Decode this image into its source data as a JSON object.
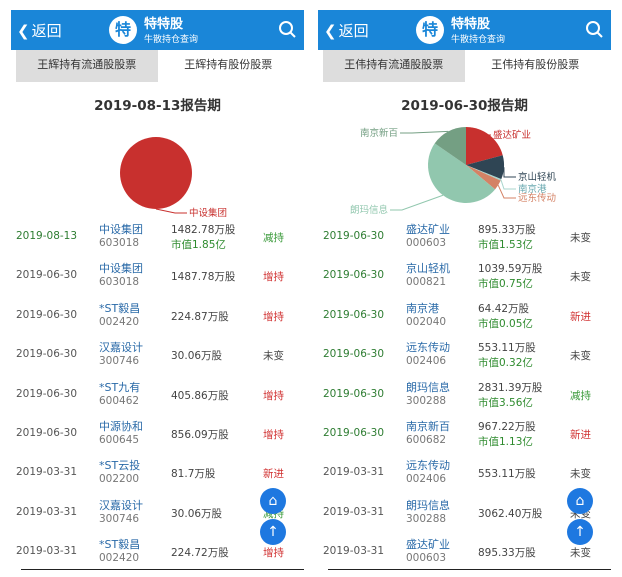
{
  "app": {
    "back_label": "返回",
    "logo_char": "特",
    "title": "特特股",
    "subtitle": "牛散持仓查询"
  },
  "panels": [
    {
      "tabs": [
        "王辉持有流通股股票",
        "王辉持有股份股票"
      ],
      "active_tab": 0,
      "report_title": "2019-08-13报告期",
      "chart_data": {
        "type": "pie",
        "slices": [
          {
            "name": "中设集团",
            "value": 1.85,
            "color": "#c8302e"
          }
        ]
      },
      "rows": [
        {
          "date": "2019-08-13",
          "name": "中设集团",
          "code": "603018",
          "shares": "1482.78万股",
          "mv": "市值1.85亿",
          "status": "减持",
          "sc": "grn",
          "hl": true
        },
        {
          "date": "2019-06-30",
          "name": "中设集团",
          "code": "603018",
          "shares": "1487.78万股",
          "status": "增持",
          "sc": "red"
        },
        {
          "date": "2019-06-30",
          "name": "*ST毅昌",
          "code": "002420",
          "shares": "224.87万股",
          "status": "增持",
          "sc": "red"
        },
        {
          "date": "2019-06-30",
          "name": "汉嘉设计",
          "code": "300746",
          "shares": "30.06万股",
          "status": "未变",
          "sc": ""
        },
        {
          "date": "2019-06-30",
          "name": "*ST九有",
          "code": "600462",
          "shares": "405.86万股",
          "status": "增持",
          "sc": "red"
        },
        {
          "date": "2019-06-30",
          "name": "中源协和",
          "code": "600645",
          "shares": "856.09万股",
          "status": "增持",
          "sc": "red"
        },
        {
          "date": "2019-03-31",
          "name": "*ST云投",
          "code": "002200",
          "shares": "81.7万股",
          "status": "新进",
          "sc": "red"
        },
        {
          "date": "2019-03-31",
          "name": "汉嘉设计",
          "code": "300746",
          "shares": "30.06万股",
          "status": "减持",
          "sc": "grn"
        },
        {
          "date": "2019-03-31",
          "name": "*ST毅昌",
          "code": "002420",
          "shares": "224.72万股",
          "status": "增持",
          "sc": "red"
        }
      ]
    },
    {
      "tabs": [
        "王伟持有流通股股票",
        "王伟持有股份股票"
      ],
      "active_tab": 0,
      "report_title": "2019-06-30报告期",
      "chart_data": {
        "type": "pie",
        "slices": [
          {
            "name": "盛达矿业",
            "value": 1.53,
            "color": "#c8302e"
          },
          {
            "name": "京山轻机",
            "value": 0.75,
            "color": "#2f4554"
          },
          {
            "name": "南京港",
            "value": 0.05,
            "color": "#a8d5cc"
          },
          {
            "name": "远东传动",
            "value": 0.32,
            "color": "#d48265"
          },
          {
            "name": "朗玛信息",
            "value": 3.56,
            "color": "#91c7ae"
          },
          {
            "name": "南京新百",
            "value": 1.13,
            "color": "#749f83"
          }
        ]
      },
      "rows": [
        {
          "date": "2019-06-30",
          "name": "盛达矿业",
          "code": "000603",
          "shares": "895.33万股",
          "mv": "市值1.53亿",
          "status": "未变",
          "sc": "",
          "hl": true
        },
        {
          "date": "2019-06-30",
          "name": "京山轻机",
          "code": "000821",
          "shares": "1039.59万股",
          "mv": "市值0.75亿",
          "status": "未变",
          "sc": "",
          "hl": true
        },
        {
          "date": "2019-06-30",
          "name": "南京港",
          "code": "002040",
          "shares": "64.42万股",
          "mv": "市值0.05亿",
          "status": "新进",
          "sc": "red",
          "hl": true
        },
        {
          "date": "2019-06-30",
          "name": "远东传动",
          "code": "002406",
          "shares": "553.11万股",
          "mv": "市值0.32亿",
          "status": "未变",
          "sc": "",
          "hl": true
        },
        {
          "date": "2019-06-30",
          "name": "朗玛信息",
          "code": "300288",
          "shares": "2831.39万股",
          "mv": "市值3.56亿",
          "status": "减持",
          "sc": "grn",
          "hl": true
        },
        {
          "date": "2019-06-30",
          "name": "南京新百",
          "code": "600682",
          "shares": "967.22万股",
          "mv": "市值1.13亿",
          "status": "新进",
          "sc": "red",
          "hl": true
        },
        {
          "date": "2019-03-31",
          "name": "远东传动",
          "code": "002406",
          "shares": "553.11万股",
          "status": "未变",
          "sc": ""
        },
        {
          "date": "2019-03-31",
          "name": "朗玛信息",
          "code": "300288",
          "shares": "3062.40万股",
          "status": "未变",
          "sc": ""
        },
        {
          "date": "2019-03-31",
          "name": "盛达矿业",
          "code": "000603",
          "shares": "895.33万股",
          "status": "未变",
          "sc": ""
        }
      ]
    }
  ]
}
